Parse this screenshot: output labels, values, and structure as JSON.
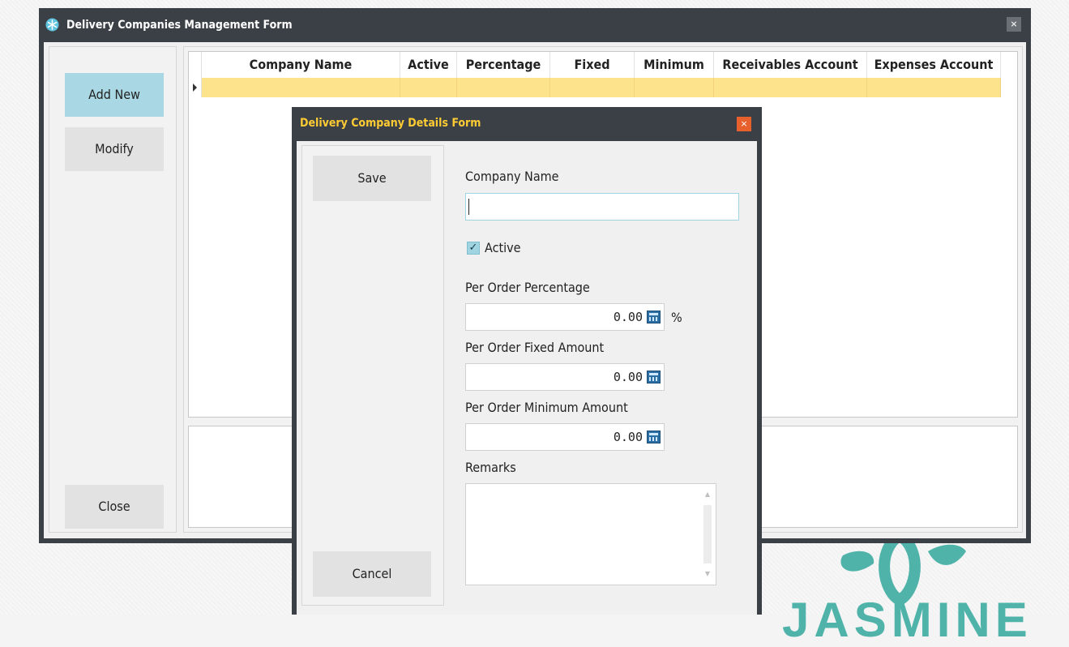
{
  "main_window": {
    "title": "Delivery Companies Management Form",
    "close_glyph": "×",
    "app_icon": "snowflake-icon"
  },
  "side_buttons": {
    "add_new": "Add New",
    "modify": "Modify",
    "close": "Close"
  },
  "grid": {
    "columns": [
      "Company Name",
      "Active",
      "Percentage",
      "Fixed",
      "Minimum",
      "Receivables Account",
      "Expenses Account"
    ],
    "selected_row_color": "#fde38c"
  },
  "dialog": {
    "title": "Delivery Company Details Form",
    "close_glyph": "×",
    "save_label": "Save",
    "cancel_label": "Cancel",
    "company_name_label": "Company Name",
    "company_name_value": "",
    "active_label": "Active",
    "active_checked": true,
    "checkmark": "✓",
    "percentage_label": "Per Order Percentage",
    "percentage_value": "0.00",
    "percent_sign": "%",
    "fixed_label": "Per Order Fixed Amount",
    "fixed_value": "0.00",
    "minimum_label": "Per Order Minimum Amount",
    "minimum_value": "0.00",
    "remarks_label": "Remarks",
    "remarks_value": "",
    "scroll_up_glyph": "▲",
    "scroll_down_glyph": "▼"
  },
  "background_logo": {
    "text": "JASMINE",
    "color": "#4fb3aa"
  },
  "colors": {
    "window_frame": "#3b4046",
    "dialog_title": "#ffcc33",
    "dialog_close": "#e8602c",
    "accent_button": "#a9d8e4"
  }
}
